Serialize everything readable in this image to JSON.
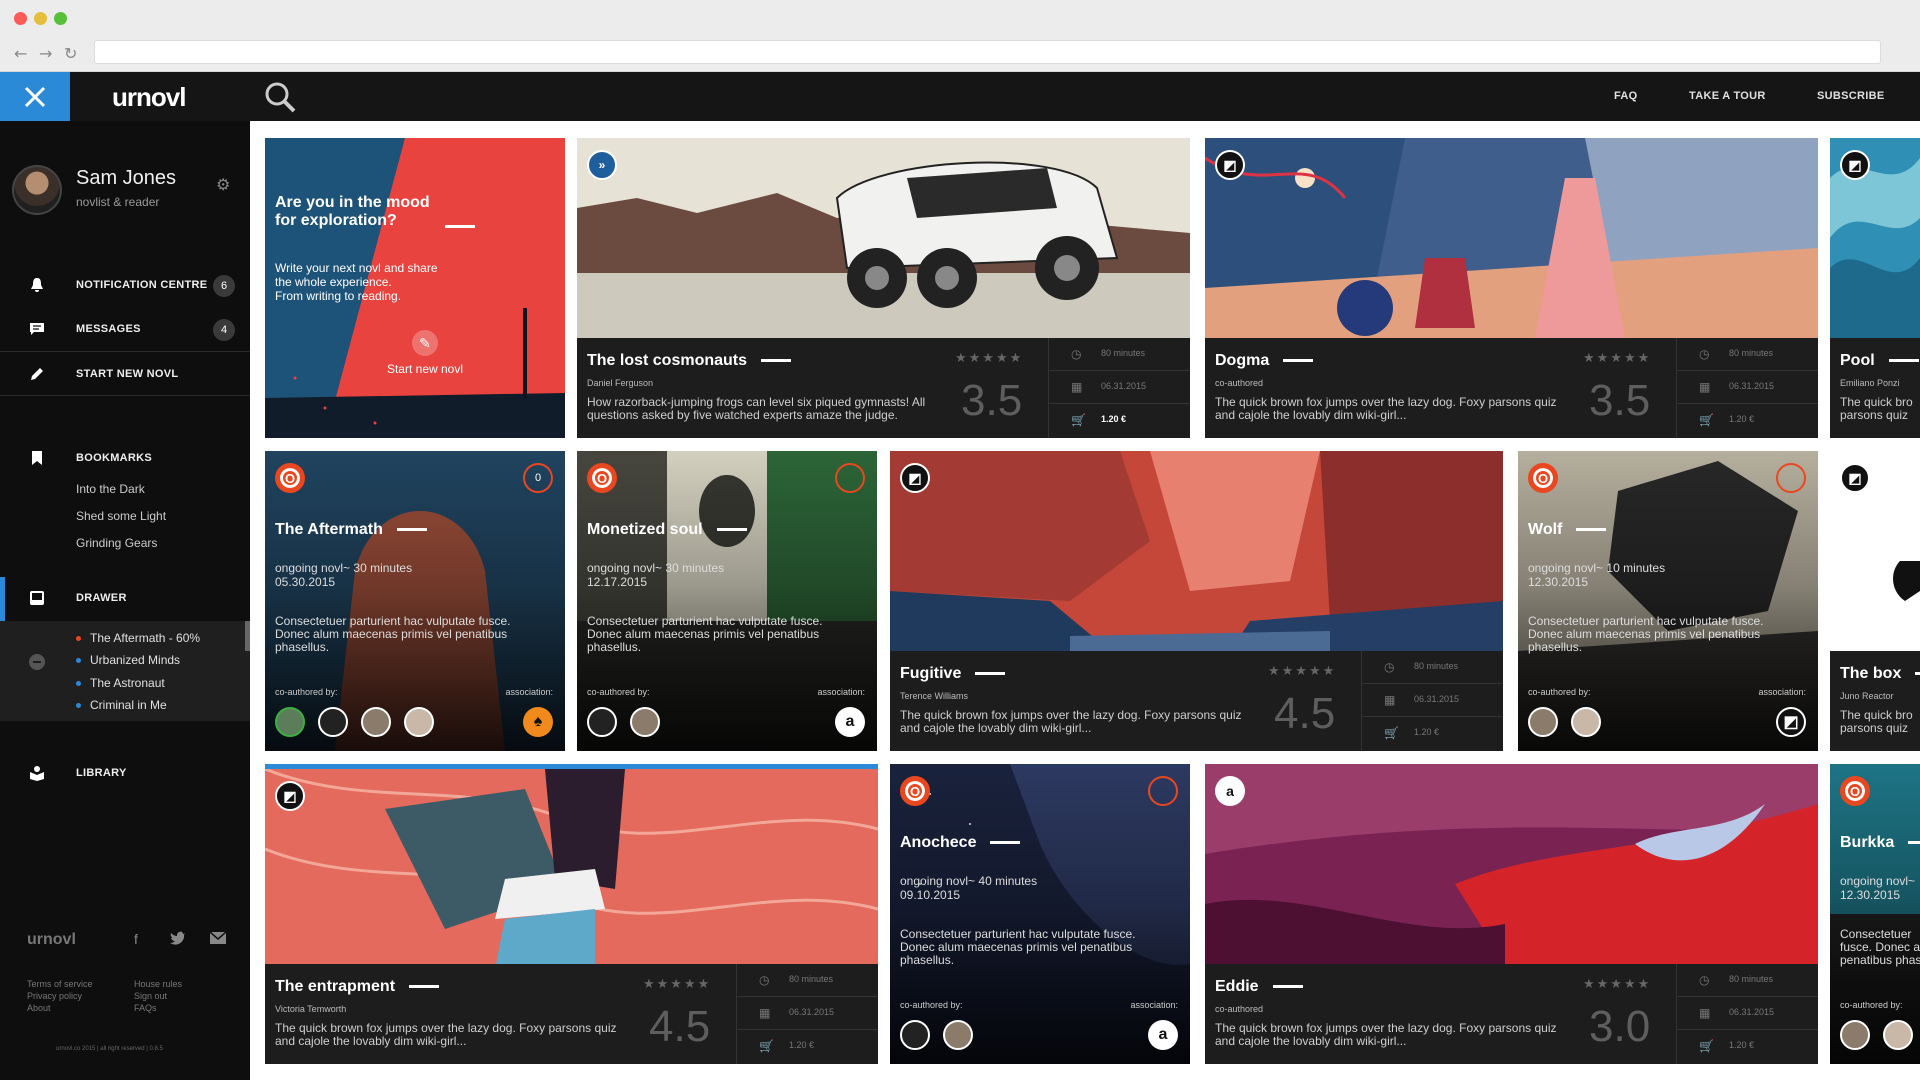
{
  "app": {
    "logo": "urnovl"
  },
  "topnav": {
    "faq": "FAQ",
    "tour": "TAKE A TOUR",
    "subscribe": "SUBSCRIBE"
  },
  "user": {
    "name": "Sam Jones",
    "role": "novlist & reader"
  },
  "sidebar": {
    "notifications": {
      "label": "NOTIFICATION CENTRE",
      "count": "6"
    },
    "messages": {
      "label": "MESSAGES",
      "count": "4"
    },
    "start_new": {
      "label": "START NEW NOVL"
    },
    "bookmarks": {
      "label": "BOOKMARKS",
      "items": [
        "Into the Dark",
        "Shed some Light",
        "Grinding Gears"
      ]
    },
    "drawer": {
      "label": "DRAWER",
      "items": [
        "The Aftermath - 60%",
        "Urbanized Minds",
        "The Astronaut",
        "Criminal in Me"
      ],
      "dot_colors": [
        "#e9471f",
        "#2a8ad8",
        "#2a8ad8",
        "#2a8ad8"
      ]
    },
    "library": {
      "label": "LIBRARY"
    },
    "footer": {
      "logo": "urnovl",
      "links_left": [
        "Terms of service",
        "Privacy policy",
        "About"
      ],
      "links_right": [
        "House rules",
        "Sign out",
        "FAQs"
      ],
      "copyright": "urnovl.co 2015 | all right reserved | 0.8.5"
    }
  },
  "promo": {
    "title_line1": "Are you in the mood",
    "title_line2": "for exploration?",
    "body_line1": "Write your next novl and share",
    "body_line2": "the whole experience.",
    "body_line3": "From writing to reading.",
    "cta": "Start new novl"
  },
  "cards": {
    "cosmonauts": {
      "title": "The lost cosmonauts",
      "author": "Daniel Ferguson",
      "desc": "How razorback-jumping frogs can level six piqued gymnasts! All questions asked by five watched experts amaze the judge.",
      "stars": "★★★★★",
      "rating": "3.5",
      "duration": "80 minutes",
      "date": "06.31.2015",
      "price": "1.20 €"
    },
    "dogma": {
      "title": "Dogma",
      "author": "co-authored",
      "desc": "The quick brown fox jumps over the lazy dog. Foxy parsons quiz and cajole the lovably dim wiki-girl...",
      "stars": "★★★★★",
      "rating": "3.5",
      "duration": "80 minutes",
      "date": "06.31.2015",
      "price": "1.20 €"
    },
    "pool": {
      "title": "Pool",
      "author": "Emiliano Ponzi",
      "desc": "The quick bro parsons quiz"
    },
    "aftermath": {
      "title": "The Aftermath",
      "ongoing": "ongoing novl~ 30 minutes",
      "date": "05.30.2015",
      "desc": "Consectetuer parturient hac vulputate fusce. Donec alum maecenas primis vel penatibus phasellus.",
      "co": "co-authored by:",
      "assoc": "association:",
      "ring": "0"
    },
    "monetized": {
      "title": "Monetized soul",
      "ongoing": "ongoing novl~ 30 minutes",
      "date": "12.17.2015",
      "desc": "Consectetuer parturient hac vulputate fusce. Donec alum maecenas primis vel penatibus phasellus.",
      "co": "co-authored by:",
      "assoc": "association:"
    },
    "fugitive": {
      "title": "Fugitive",
      "author": "Terence Williams",
      "desc": "The quick brown fox jumps over the lazy dog. Foxy parsons quiz and cajole the lovably dim wiki-girl...",
      "stars": "★★★★★",
      "rating": "4.5",
      "duration": "80 minutes",
      "date": "06.31.2015",
      "price": "1.20 €"
    },
    "wolf": {
      "title": "Wolf",
      "ongoing": "ongoing novl~ 10 minutes",
      "date": "12.30.2015",
      "desc": "Consectetuer parturient hac vulputate fusce. Donec alum maecenas primis vel penatibus phasellus.",
      "co": "co-authored by:",
      "assoc": "association:"
    },
    "thebox": {
      "title": "The box",
      "author": "Juno Reactor",
      "desc": "The quick bro parsons quiz"
    },
    "entrapment": {
      "title": "The entrapment",
      "author": "Victoria Temworth",
      "desc": "The quick brown fox jumps over the lazy dog. Foxy parsons quiz and cajole the lovably dim wiki-girl...",
      "stars": "★★★★★",
      "rating": "4.5",
      "duration": "80 minutes",
      "date": "06.31.2015",
      "price": "1.20 €"
    },
    "anochece": {
      "title": "Anochece",
      "ongoing": "ongoing novl~ 40 minutes",
      "date": "09.10.2015",
      "desc": "Consectetuer parturient hac vulputate fusce. Donec alum maecenas primis vel penatibus phasellus.",
      "co": "co-authored by:",
      "assoc": "association:"
    },
    "eddie": {
      "title": "Eddie",
      "author": "co-authored",
      "desc": "The quick brown fox jumps over the lazy dog. Foxy parsons quiz and cajole the lovably dim wiki-girl...",
      "stars": "★★★★★",
      "rating": "3.0",
      "duration": "80 minutes",
      "date": "06.31.2015",
      "price": "1.20 €"
    },
    "burkka": {
      "title": "Burkka",
      "ongoing": "ongoing novl~",
      "date": "12.30.2015",
      "desc": "Consectetuer fusce. Donec a penatibus phas",
      "co": "co-authored by:"
    }
  },
  "colors": {
    "accent": "#2a8ad8",
    "publisher_orange": "#e9471f",
    "appbar": "#151515",
    "sidebar": "#0e0e0e"
  }
}
